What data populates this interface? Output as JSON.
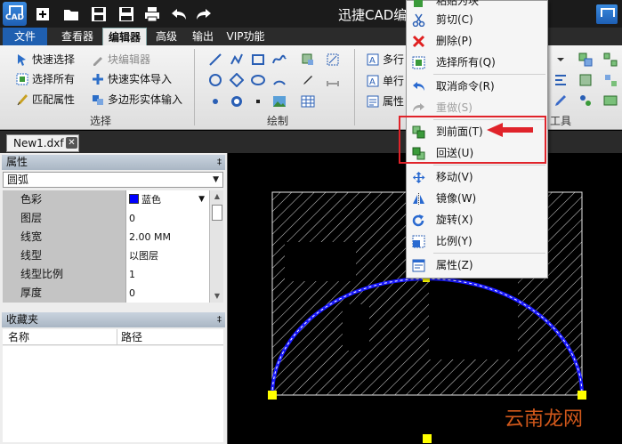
{
  "window": {
    "title": "迅捷CAD编",
    "logo_text": "CAD"
  },
  "menu_tabs": [
    "文件",
    "查看器",
    "编辑器",
    "高级",
    "输出",
    "VIP功能"
  ],
  "active_tab": "编辑器",
  "ribbon": {
    "select_group": {
      "label": "选择",
      "buttons": [
        "快速选择",
        "块编辑器",
        "选择所有",
        "快速实体导入",
        "匹配属性",
        "多边形实体输入"
      ]
    },
    "draw_group": {
      "label": "绘制"
    },
    "text_group": {
      "visible_buttons": [
        "多行",
        "单行",
        "属性"
      ]
    },
    "tools_group": {
      "label": "工具"
    }
  },
  "doc_tab": {
    "name": "New1.dxf",
    "close": "✕"
  },
  "properties_panel": {
    "title": "属性",
    "pin": "‡",
    "entity_type": "圆弧",
    "rows": [
      {
        "name": "色彩",
        "value": "蓝色",
        "swatch": "#0000ff"
      },
      {
        "name": "图层",
        "value": "0"
      },
      {
        "name": "线宽",
        "value": "2.00 MM"
      },
      {
        "name": "线型",
        "value": "以图层"
      },
      {
        "name": "线型比例",
        "value": "1"
      },
      {
        "name": "厚度",
        "value": "0"
      }
    ]
  },
  "favorites_panel": {
    "title": "收藏夹",
    "pin": "‡",
    "columns": [
      "名称",
      "路径"
    ]
  },
  "context_menu": {
    "partial_top": "粘贴为块",
    "items": [
      {
        "label": "剪切(C)",
        "icon": "scissors-icon"
      },
      {
        "label": "删除(P)",
        "icon": "delete-x-icon"
      },
      {
        "label": "选择所有(Q)",
        "icon": "select-all-icon"
      },
      {
        "label": "取消命令(R)",
        "icon": "undo-arrow-icon"
      },
      {
        "label": "重做(S)",
        "icon": "redo-arrow-icon",
        "disabled": true
      },
      {
        "label": "到前面(T)",
        "icon": "bring-to-front-icon"
      },
      {
        "label": "回送(U)",
        "icon": "send-back-icon"
      },
      {
        "label": "移动(V)",
        "icon": "move-icon"
      },
      {
        "label": "镜像(W)",
        "icon": "mirror-icon"
      },
      {
        "label": "旋转(X)",
        "icon": "rotate-icon"
      },
      {
        "label": "比例(Y)",
        "icon": "scale-icon"
      },
      {
        "label": "属性(Z)",
        "icon": "properties-icon"
      }
    ]
  },
  "colors": {
    "accent_blue": "#1f5fb0",
    "arc_blue": "#0000ff",
    "highlight_red": "#e0232a",
    "grip_yellow": "#ffff00"
  },
  "watermark": "云南龙网"
}
